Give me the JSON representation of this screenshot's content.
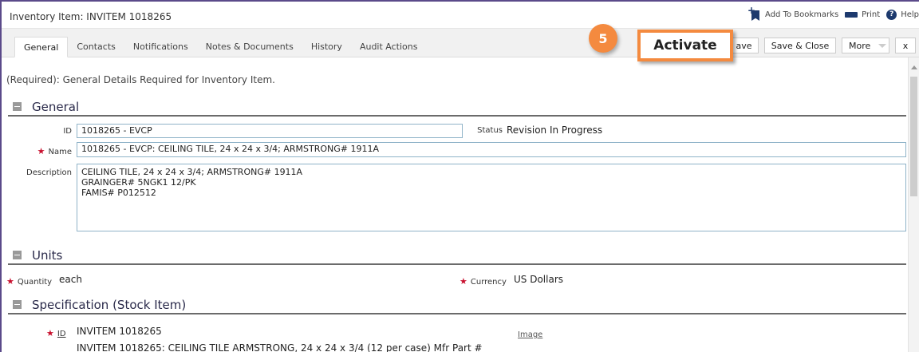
{
  "window": {
    "title": "Inventory Item: INVITEM 1018265"
  },
  "top_actions": {
    "bookmarks": "Add To Bookmarks",
    "print": "Print",
    "help": "Help"
  },
  "tabs": [
    "General",
    "Contacts",
    "Notifications",
    "Notes & Documents",
    "History",
    "Audit Actions"
  ],
  "buttons": {
    "save_partial": "ave",
    "save_close": "Save & Close",
    "more": "More",
    "close": "x"
  },
  "callout": {
    "step": "5",
    "activate_label": "Activate"
  },
  "required_note": "(Required): General Details Required for Inventory Item.",
  "general": {
    "title": "General",
    "id_label": "ID",
    "id_value": "1018265 - EVCP",
    "status_label": "Status",
    "status_value": "Revision In Progress",
    "name_label": "Name",
    "name_value": "1018265 - EVCP: CEILING TILE, 24 x 24 x 3/4; ARMSTRONG# 1911A",
    "description_label": "Description",
    "description_lines": [
      "CEILING TILE, 24 x 24 x 3/4; ARMSTRONG# 1911A",
      "GRAINGER# 5NGK1 12/PK",
      "FAMIS# P012512"
    ]
  },
  "units": {
    "title": "Units",
    "quantity_label": "Quantity",
    "quantity_value": "each",
    "currency_label": "Currency",
    "currency_value": "US Dollars"
  },
  "spec": {
    "title": "Specification (Stock Item)",
    "id_label": "ID",
    "id_value": "INVITEM 1018265",
    "image_link": "Image",
    "desc_value": "INVITEM 1018265: CEILING TILE ARMSTRONG, 24 x 24 x 3/4 (12 per case) Mfr Part #"
  },
  "colors": {
    "accent": "#f48a3f",
    "section_rule": "#6b6b6b",
    "field_border": "#8fb3c8",
    "required": "#c8102e"
  }
}
